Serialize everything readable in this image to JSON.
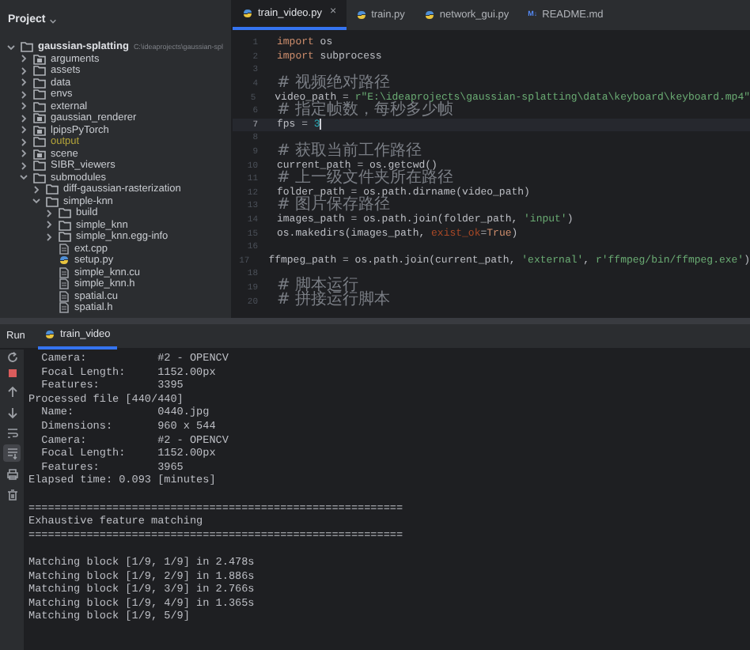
{
  "sidebar": {
    "title": "Project",
    "tree": [
      {
        "label": "gaussian-splatting",
        "kind": "root",
        "path": "C:\\ideaprojects\\gaussian-spl",
        "expanded": true,
        "children": [
          {
            "label": "arguments",
            "kind": "module",
            "expanded": false
          },
          {
            "label": "assets",
            "kind": "folder",
            "expanded": false
          },
          {
            "label": "data",
            "kind": "folder",
            "expanded": false
          },
          {
            "label": "envs",
            "kind": "folder",
            "expanded": false
          },
          {
            "label": "external",
            "kind": "folder",
            "expanded": false
          },
          {
            "label": "gaussian_renderer",
            "kind": "module",
            "expanded": false
          },
          {
            "label": "lpipsPyTorch",
            "kind": "module",
            "expanded": false
          },
          {
            "label": "output",
            "kind": "folder",
            "excluded": true,
            "expanded": false
          },
          {
            "label": "scene",
            "kind": "module",
            "expanded": false
          },
          {
            "label": "SIBR_viewers",
            "kind": "folder",
            "expanded": false
          },
          {
            "label": "submodules",
            "kind": "folder",
            "expanded": true,
            "children": [
              {
                "label": "diff-gaussian-rasterization",
                "kind": "folder",
                "expanded": false
              },
              {
                "label": "simple-knn",
                "kind": "folder",
                "expanded": true,
                "children": [
                  {
                    "label": "build",
                    "kind": "folder",
                    "expanded": false
                  },
                  {
                    "label": "simple_knn",
                    "kind": "folder",
                    "expanded": false
                  },
                  {
                    "label": "simple_knn.egg-info",
                    "kind": "folder",
                    "expanded": false
                  },
                  {
                    "label": "ext.cpp",
                    "kind": "file"
                  },
                  {
                    "label": "setup.py",
                    "kind": "python"
                  },
                  {
                    "label": "simple_knn.cu",
                    "kind": "file"
                  },
                  {
                    "label": "simple_knn.h",
                    "kind": "file"
                  },
                  {
                    "label": "spatial.cu",
                    "kind": "file"
                  },
                  {
                    "label": "spatial.h",
                    "kind": "file"
                  }
                ]
              }
            ]
          }
        ]
      }
    ]
  },
  "editor": {
    "tabs": [
      {
        "label": "train_video.py",
        "kind": "python",
        "selected": true,
        "close": "×"
      },
      {
        "label": "train.py",
        "kind": "python",
        "selected": false
      },
      {
        "label": "network_gui.py",
        "kind": "python",
        "selected": false
      },
      {
        "label": "README.md",
        "kind": "markdown",
        "badge": "M↓",
        "selected": false
      }
    ],
    "lines": [
      {
        "number": "1",
        "current": false,
        "tokens": [
          {
            "kind": "keyword",
            "text": "import"
          },
          {
            "kind": "plain",
            "text": " os"
          }
        ]
      },
      {
        "number": "2",
        "current": false,
        "tokens": [
          {
            "kind": "keyword",
            "text": "import"
          },
          {
            "kind": "plain",
            "text": " subprocess"
          }
        ]
      },
      {
        "number": "3",
        "current": false
      },
      {
        "number": "4",
        "current": false,
        "tokens": [
          {
            "kind": "comment",
            "text": "# 视频绝对路径"
          }
        ]
      },
      {
        "number": "5",
        "current": false,
        "tokens": [
          {
            "kind": "plain",
            "text": "video_path = "
          },
          {
            "kind": "string",
            "text": "r\"E:\\ideaprojects\\gaussian-splatting\\data\\keyboard\\keyboard.mp4\""
          }
        ]
      },
      {
        "number": "6",
        "current": false,
        "tokens": [
          {
            "kind": "comment",
            "text": "# 指定帧数，每秒多少帧"
          }
        ]
      },
      {
        "number": "7",
        "current": true,
        "tokens": [
          {
            "kind": "plain",
            "text": "fps = "
          },
          {
            "kind": "number",
            "text": "3"
          }
        ]
      },
      {
        "number": "8",
        "current": false
      },
      {
        "number": "9",
        "current": false,
        "tokens": [
          {
            "kind": "comment",
            "text": "# 获取当前工作路径"
          }
        ]
      },
      {
        "number": "10",
        "current": false,
        "tokens": [
          {
            "kind": "plain",
            "text": "current_path = os.getcwd()"
          }
        ]
      },
      {
        "number": "11",
        "current": false,
        "tokens": [
          {
            "kind": "comment",
            "text": "# 上一级文件夹所在路径"
          }
        ]
      },
      {
        "number": "12",
        "current": false,
        "tokens": [
          {
            "kind": "plain",
            "text": "folder_path = os.path.dirname(video_path)"
          }
        ]
      },
      {
        "number": "13",
        "current": false,
        "tokens": [
          {
            "kind": "comment",
            "text": "# 图片保存路径"
          }
        ]
      },
      {
        "number": "14",
        "current": false,
        "tokens": [
          {
            "kind": "plain",
            "text": "images_path = os.path.join(folder_path, "
          },
          {
            "kind": "string",
            "text": "'input'"
          },
          {
            "kind": "plain",
            "text": ")"
          }
        ]
      },
      {
        "number": "15",
        "current": false,
        "tokens": [
          {
            "kind": "plain",
            "text": "os.makedirs(images_path, "
          },
          {
            "kind": "param",
            "text": "exist_ok"
          },
          {
            "kind": "plain",
            "text": "="
          },
          {
            "kind": "keyword",
            "text": "True"
          },
          {
            "kind": "plain",
            "text": ")"
          }
        ]
      },
      {
        "number": "16",
        "current": false
      },
      {
        "number": "17",
        "current": false,
        "tokens": [
          {
            "kind": "plain",
            "text": "ffmpeg_path = os.path.join(current_path, "
          },
          {
            "kind": "string",
            "text": "'external'"
          },
          {
            "kind": "plain",
            "text": ", "
          },
          {
            "kind": "string",
            "text": "r'ffmpeg/bin/ffmpeg.exe'"
          },
          {
            "kind": "plain",
            "text": ")"
          }
        ]
      },
      {
        "number": "18",
        "current": false
      },
      {
        "number": "19",
        "current": false,
        "tokens": [
          {
            "kind": "comment",
            "text": "# 脚本运行"
          }
        ]
      },
      {
        "number": "20",
        "current": false,
        "tokens": [
          {
            "kind": "comment",
            "text": "# 拼接运行脚本"
          }
        ]
      }
    ]
  },
  "run": {
    "title": "Run",
    "tabs": [
      {
        "label": "train_video",
        "selected": true
      }
    ],
    "console": [
      {
        "kind": "text",
        "text": "  Camera:           #2 - OPENCV"
      },
      {
        "kind": "text",
        "text": "  Focal Length:     1152.00px"
      },
      {
        "kind": "text",
        "text": "  Features:         3395"
      },
      {
        "kind": "text",
        "text": "Processed file [440/440]"
      },
      {
        "kind": "text",
        "text": "  Name:             0440.jpg"
      },
      {
        "kind": "text",
        "text": "  Dimensions:       960 x 544"
      },
      {
        "kind": "text",
        "text": "  Camera:           #2 - OPENCV"
      },
      {
        "kind": "text",
        "text": "  Focal Length:     1152.00px"
      },
      {
        "kind": "text",
        "text": "  Features:         3965"
      },
      {
        "kind": "text",
        "text": "Elapsed time: 0.093 [minutes]"
      },
      {
        "kind": "blank"
      },
      {
        "kind": "text",
        "text": "=========================================================="
      },
      {
        "kind": "text",
        "text": "Exhaustive feature matching"
      },
      {
        "kind": "text",
        "text": "=========================================================="
      },
      {
        "kind": "blank"
      },
      {
        "kind": "text",
        "text": "Matching block [1/9, 1/9] in 2.478s"
      },
      {
        "kind": "text",
        "text": "Matching block [1/9, 2/9] in 1.886s"
      },
      {
        "kind": "text",
        "text": "Matching block [1/9, 3/9] in 2.766s"
      },
      {
        "kind": "text",
        "text": "Matching block [1/9, 4/9] in 1.365s"
      },
      {
        "kind": "text",
        "text": "Matching block [1/9, 5/9]"
      }
    ]
  }
}
